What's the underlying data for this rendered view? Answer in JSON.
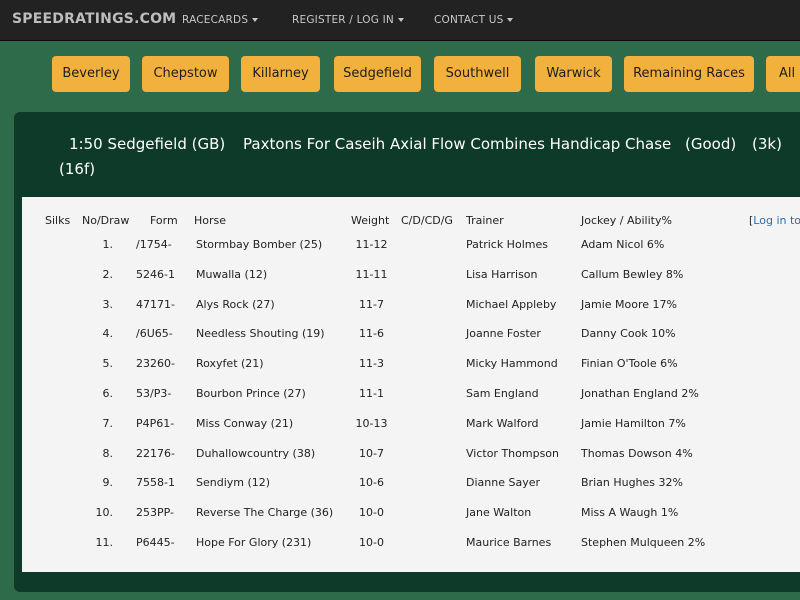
{
  "navbar": {
    "brand": "SPEEDRATINGS.COM",
    "links": [
      {
        "label": "RACECARDS"
      },
      {
        "label": "REGISTER / LOG IN"
      },
      {
        "label": "CONTACT US"
      }
    ]
  },
  "courses": [
    "Beverley",
    "Chepstow",
    "Killarney",
    "Sedgefield",
    "Southwell",
    "Warwick",
    "Remaining Races",
    "All R"
  ],
  "race": {
    "time_course": "1:50 Sedgefield (GB)",
    "name": "Paxtons For Caseih Axial Flow Combines Handicap Chase",
    "going": "(Good)",
    "class": "(3k)",
    "distance": "(16f)"
  },
  "table": {
    "headers": {
      "silks": "Silks",
      "no_draw": "No/Draw",
      "form": "Form",
      "horse": "Horse",
      "weight": "Weight",
      "cdcdg": "C/D/CD/G",
      "trainer": "Trainer",
      "jockey": "Jockey / Ability%"
    },
    "login_prefix": "[",
    "login_link": "Log in to",
    "rows": [
      {
        "no": "1.",
        "form": "/1754-",
        "horse": "Stormbay Bomber (25)",
        "weight": "11-12",
        "trainer": "Patrick Holmes",
        "jockey": "Adam Nicol 6%"
      },
      {
        "no": "2.",
        "form": "5246-1",
        "horse": "Muwalla (12)",
        "weight": "11-11",
        "trainer": "Lisa Harrison",
        "jockey": "Callum Bewley 8%"
      },
      {
        "no": "3.",
        "form": "47171-",
        "horse": "Alys Rock (27)",
        "weight": "11-7",
        "trainer": "Michael Appleby",
        "jockey": "Jamie Moore 17%"
      },
      {
        "no": "4.",
        "form": "/6U65-",
        "horse": "Needless Shouting (19)",
        "weight": "11-6",
        "trainer": "Joanne Foster",
        "jockey": "Danny Cook 10%"
      },
      {
        "no": "5.",
        "form": "23260-",
        "horse": "Roxyfet (21)",
        "weight": "11-3",
        "trainer": "Micky Hammond",
        "jockey": "Finian O'Toole 6%"
      },
      {
        "no": "6.",
        "form": "53/P3-",
        "horse": "Bourbon Prince (27)",
        "weight": "11-1",
        "trainer": "Sam England",
        "jockey": "Jonathan England 2%"
      },
      {
        "no": "7.",
        "form": "P4P61-",
        "horse": "Miss Conway (21)",
        "weight": "10-13",
        "trainer": "Mark Walford",
        "jockey": "Jamie Hamilton 7%"
      },
      {
        "no": "8.",
        "form": "22176-",
        "horse": "Duhallowcountry (38)",
        "weight": "10-7",
        "trainer": "Victor Thompson",
        "jockey": "Thomas Dowson 4%"
      },
      {
        "no": "9.",
        "form": "7558-1",
        "horse": "Sendiym (12)",
        "weight": "10-6",
        "trainer": "Dianne Sayer",
        "jockey": "Brian Hughes 32%"
      },
      {
        "no": "10.",
        "form": "253PP-",
        "horse": "Reverse The Charge (36)",
        "weight": "10-0",
        "trainer": "Jane Walton",
        "jockey": "Miss A Waugh 1%"
      },
      {
        "no": "11.",
        "form": "P6445-",
        "horse": "Hope For Glory (231)",
        "weight": "10-0",
        "trainer": "Maurice Barnes",
        "jockey": "Stephen Mulqueen 2%"
      }
    ]
  }
}
